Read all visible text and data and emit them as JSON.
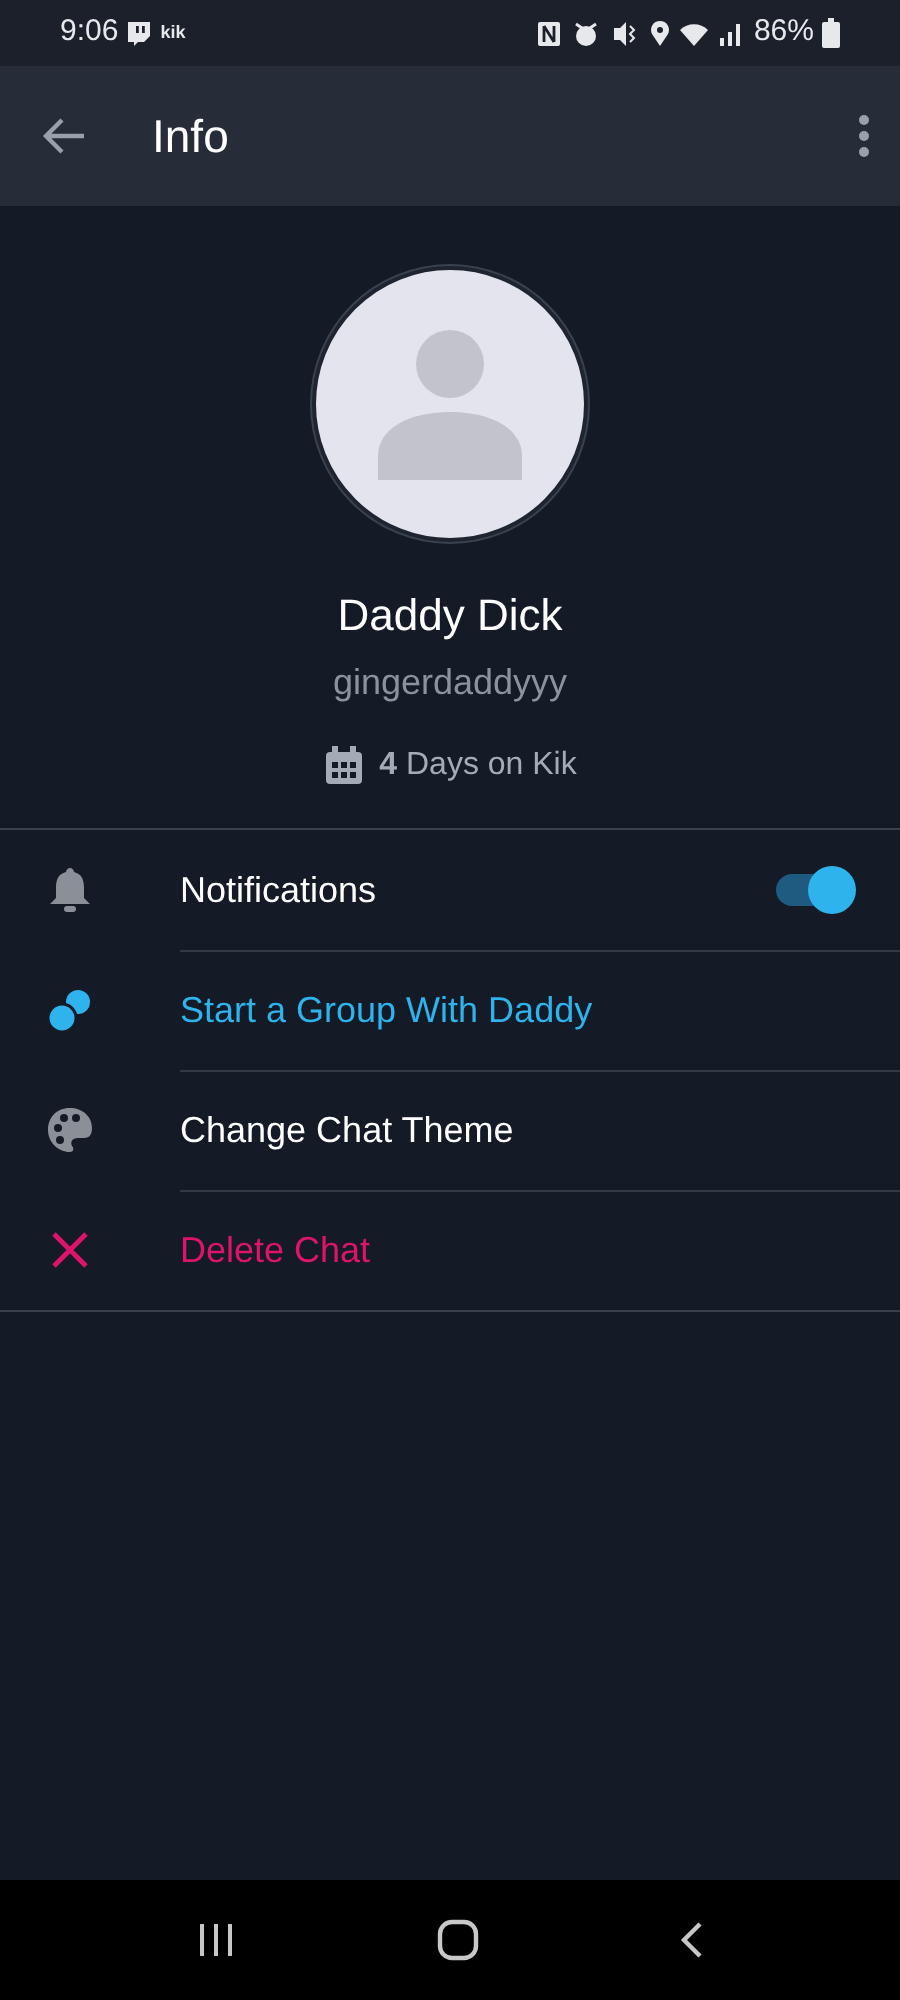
{
  "status_bar": {
    "time": "9:06",
    "app_badge": "kik",
    "battery": "86%"
  },
  "app_bar": {
    "title": "Info"
  },
  "profile": {
    "display_name": "Daddy Dick",
    "username": "gingerdaddyyy",
    "membership": "**4** Days on Kik"
  },
  "items": [
    {
      "kind": "toggle",
      "label": "Notifications",
      "color": "#ffffff",
      "on": true
    },
    {
      "kind": "group",
      "label": "Start a Group With Daddy",
      "color": "#2eb3ec"
    },
    {
      "kind": "theme",
      "label": "Change Chat Theme",
      "color": "#ffffff"
    },
    {
      "kind": "delete",
      "label": "Delete Chat",
      "color": "#e0136c"
    }
  ]
}
